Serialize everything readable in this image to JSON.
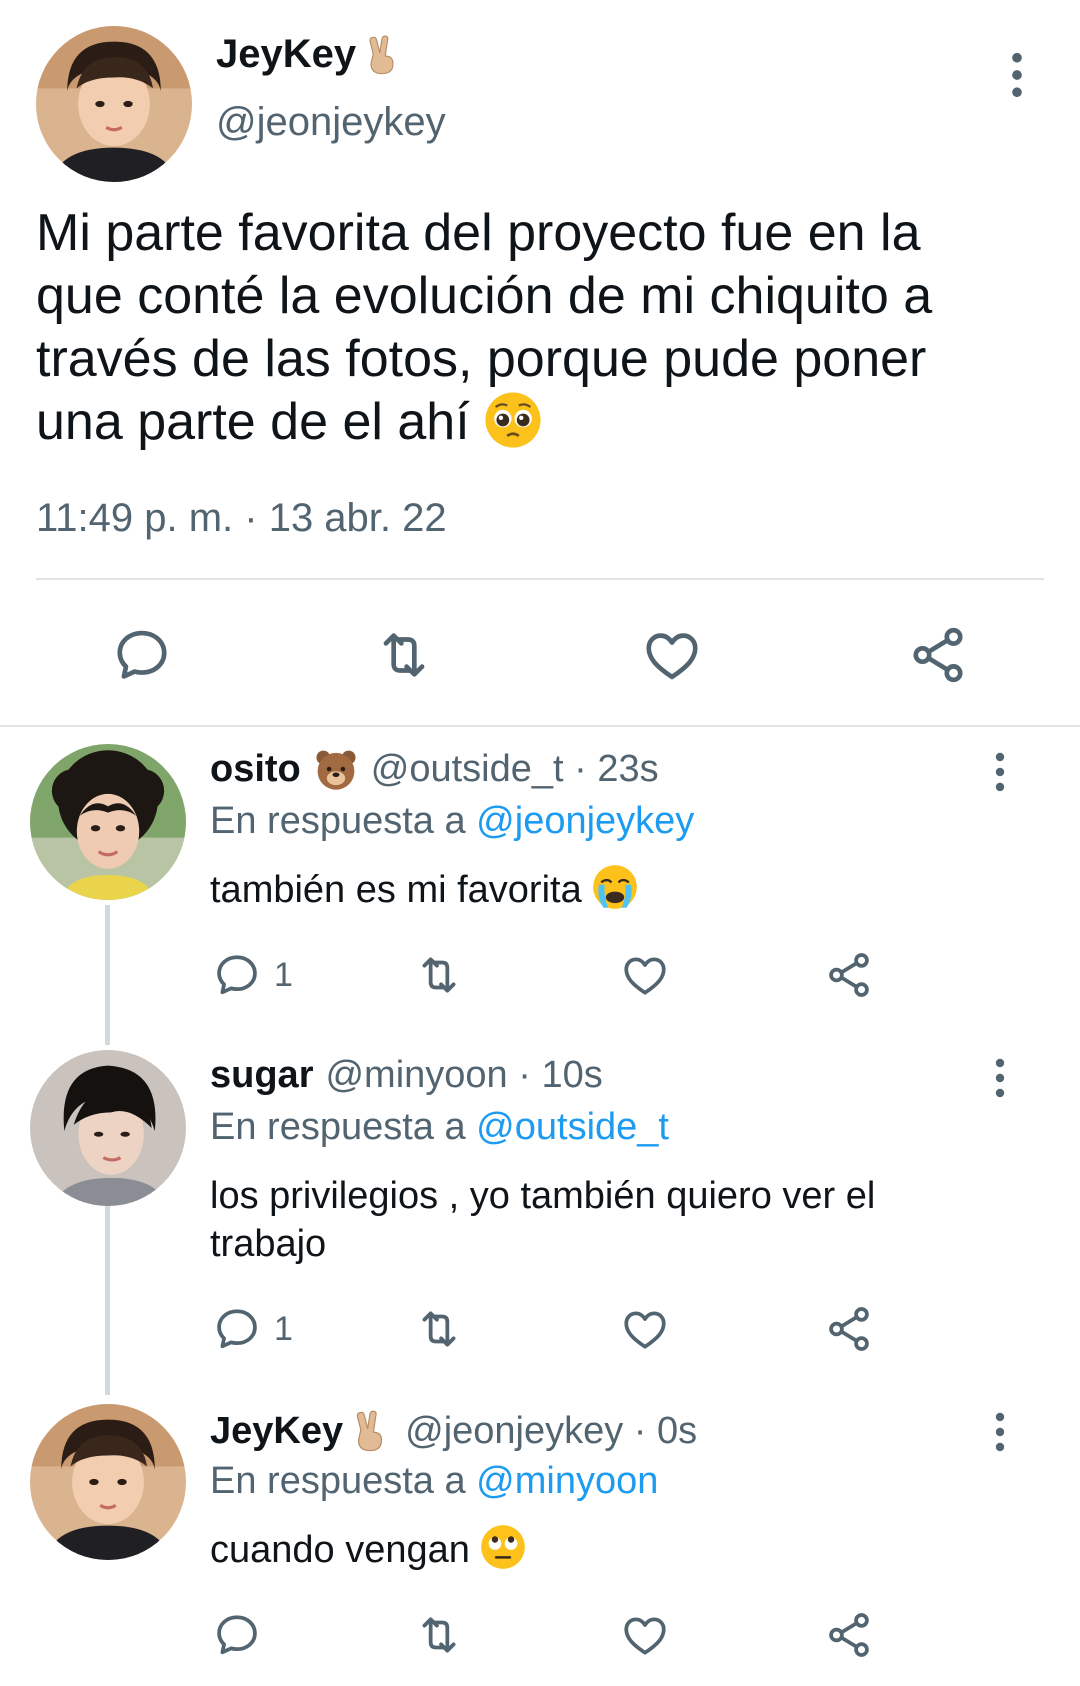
{
  "main_tweet": {
    "author_name": "JeyKey",
    "author_emoji": "✌🏼",
    "handle": "@jeonjeykey",
    "text": "Mi parte favorita del proyecto fue en la\nque conté la evolución de mi chiquito a\ntravés de las fotos, porque pude poner\nuna parte de el ahí",
    "text_emoji": "🥺",
    "timestamp": "11:49 p. m. · 13 abr. 22",
    "actions": [
      "reply-icon",
      "retweet-icon",
      "like-icon",
      "share-icon"
    ]
  },
  "replies": [
    {
      "name": "osito",
      "name_emoji": "🐻",
      "meta": "@outside_t · 23s",
      "replying_prefix": "En respuesta a",
      "replying_to": "@jeonjeykey",
      "text": "también es mi favorita",
      "text_emoji": "😭",
      "reply_count": "1"
    },
    {
      "name": "sugar",
      "name_emoji": "",
      "meta": "@minyoon · 10s",
      "replying_prefix": "En respuesta a",
      "replying_to": "@outside_t",
      "text": "los privilegios , yo también quiero ver el\ntrabajo",
      "text_emoji": "",
      "reply_count": "1"
    },
    {
      "name": "JeyKey",
      "name_emoji": "✌🏼",
      "meta": "@jeonjeykey · 0s",
      "replying_prefix": "En respuesta a",
      "replying_to": "@minyoon",
      "text": "cuando vengan",
      "text_emoji": "🙄",
      "reply_count": ""
    }
  ],
  "colors": {
    "text": "#0f1419",
    "secondary": "#536471",
    "link": "#1d9bf0",
    "divider": "#dfe3e6",
    "thread_line": "#cfd9de"
  }
}
